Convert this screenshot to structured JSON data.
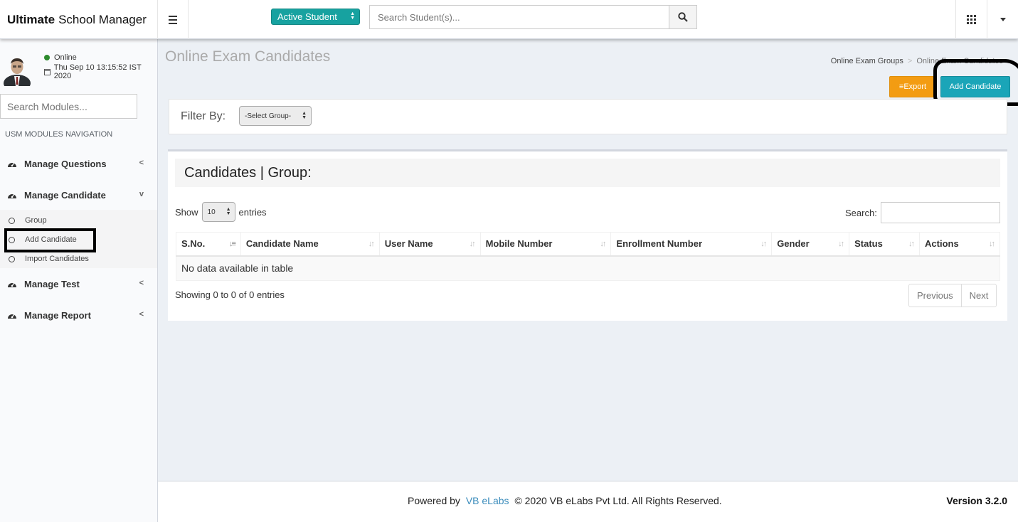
{
  "header": {
    "logo_bold": "Ultimate",
    "logo_rest": "School Manager",
    "student_filter": "Active Student",
    "search_placeholder": "Search Student(s)..."
  },
  "sidebar": {
    "status": "Online",
    "datetime": "Thu Sep 10 13:15:52 IST 2020",
    "module_search_placeholder": "Search Modules...",
    "nav_header": "USM MODULES NAVIGATION",
    "items": [
      {
        "label": "Manage Questions",
        "chevron": "<"
      },
      {
        "label": "Manage Candidate",
        "chevron": "v"
      },
      {
        "label": "Manage Test",
        "chevron": "<"
      },
      {
        "label": "Manage Report",
        "chevron": "<"
      }
    ],
    "subitems": [
      {
        "label": "Group"
      },
      {
        "label": "Add Candidate"
      },
      {
        "label": "Import Candidates"
      }
    ]
  },
  "main": {
    "page_title": "Online Exam Candidates",
    "breadcrumb": [
      "Online Exam Groups",
      "Online Exam Candidates"
    ],
    "export_label": "Export",
    "add_label": "Add Candidate",
    "filter_label": "Filter By:",
    "group_select": "-Select Group-",
    "box_title": "Candidates | Group:",
    "show_label": "Show",
    "page_length": "10",
    "entries_label": "entries",
    "search_label": "Search:",
    "columns": [
      "S.No.",
      "Candidate Name",
      "User Name",
      "Mobile Number",
      "Enrollment Number",
      "Gender",
      "Status",
      "Actions"
    ],
    "empty_message": "No data available in table",
    "info": "Showing 0 to 0 of 0 entries",
    "prev": "Previous",
    "next": "Next"
  },
  "footer": {
    "powered": "Powered by",
    "brand": "VB eLabs",
    "copyright": "© 2020 VB eLabs Pvt Ltd. All Rights Reserved.",
    "version": "Version 3.2.0"
  },
  "colors": {
    "accent_teal": "#17a2a0",
    "export_orange": "#f39c12",
    "add_button": "#1aa5b8",
    "link_blue": "#3c8dbc"
  }
}
